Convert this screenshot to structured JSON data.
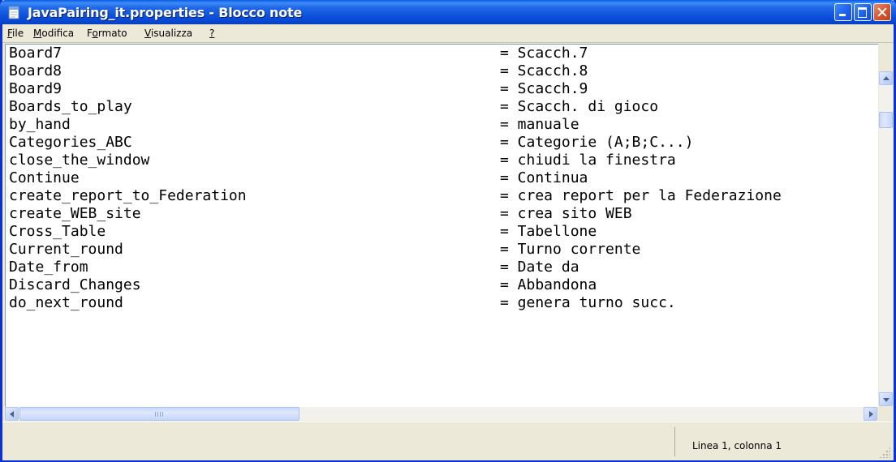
{
  "window": {
    "title": "JavaPairing_it.properties - Blocco note",
    "icon": "notepad-icon"
  },
  "menu": {
    "items": [
      {
        "accel": "F",
        "rest": "ile"
      },
      {
        "accel": "M",
        "rest": "odifica"
      },
      {
        "pre": "F",
        "accel": "o",
        "rest": "rmato"
      },
      {
        "accel": "V",
        "rest": "isualizza"
      },
      {
        "accel": "?",
        "rest": ""
      }
    ]
  },
  "editor": {
    "lines": [
      {
        "key": "Board7",
        "value": "= Scacch.7"
      },
      {
        "key": "Board8",
        "value": "= Scacch.8"
      },
      {
        "key": "Board9",
        "value": "= Scacch.9"
      },
      {
        "key": "Boards_to_play",
        "value": "= Scacch. di gioco"
      },
      {
        "key": "by_hand",
        "value": "= manuale"
      },
      {
        "key": "Categories_ABC",
        "value": "= Categorie (A;B;C...)"
      },
      {
        "key": "close_the_window",
        "value": "= chiudi la finestra"
      },
      {
        "key": "Continue",
        "value": "= Continua"
      },
      {
        "key": "create_report_to_Federation",
        "value": "= crea report per la Federazione"
      },
      {
        "key": "create_WEB_site",
        "value": "= crea sito WEB"
      },
      {
        "key": "Cross_Table",
        "value": "= Tabellone"
      },
      {
        "key": "Current_round",
        "value": "= Turno corrente"
      },
      {
        "key": "Date_from",
        "value": "= Date da"
      },
      {
        "key": "Discard_Changes",
        "value": "= Abbandona"
      },
      {
        "key": "do_next_round",
        "value": "= genera turno succ."
      }
    ]
  },
  "statusbar": {
    "position": "Linea 1, colonna 1"
  },
  "colors": {
    "titlebar": "#0a4fdc",
    "close_button": "#d9542b",
    "chrome": "#ece9d8"
  }
}
